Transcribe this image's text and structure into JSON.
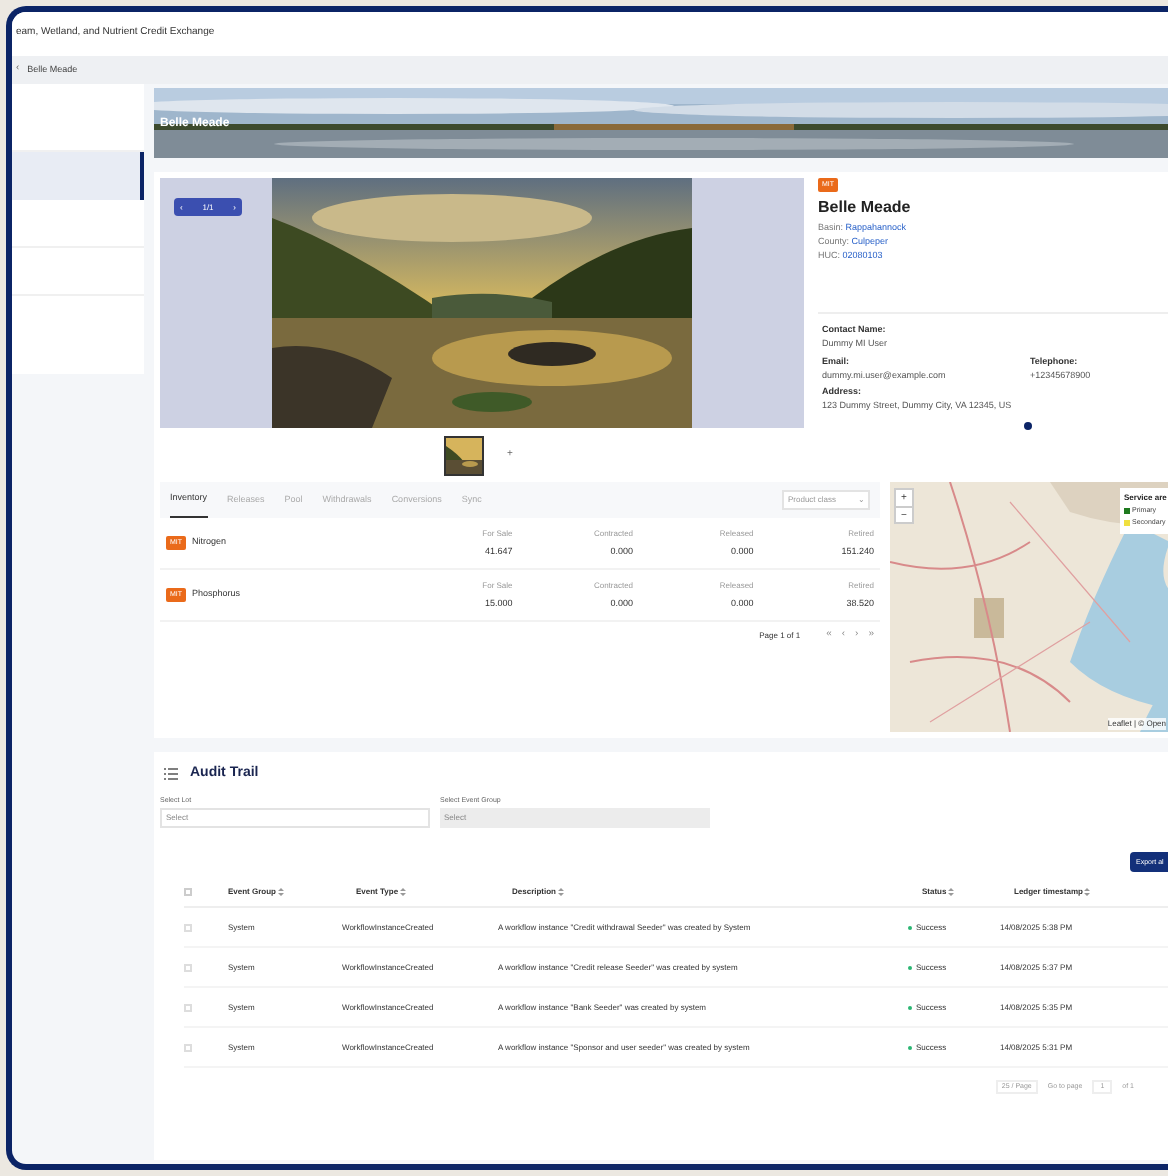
{
  "window": {
    "title": "eam, Wetland, and Nutrient Credit Exchange"
  },
  "breadcrumb": {
    "back": "‹",
    "current": "Belle Meade"
  },
  "sidebar": {
    "items": [
      {
        "selected": false
      },
      {
        "selected": true
      },
      {
        "selected": false
      },
      {
        "selected": false
      }
    ]
  },
  "banner": {
    "title": "Belle Meade"
  },
  "gallery": {
    "prev": "‹",
    "counter": "1/1",
    "next": "›",
    "thumbnails": [
      {
        "kind": "picture",
        "selected": true
      }
    ],
    "add": "+"
  },
  "site": {
    "badge": "MIT",
    "name": "Belle Meade",
    "details": [
      {
        "label": "Basin: ",
        "value": "Rappahannock"
      },
      {
        "label": "County: ",
        "value": "Culpeper"
      },
      {
        "label": "HUC: ",
        "value": "02080103"
      }
    ],
    "contact": [
      {
        "label": "Contact Name:",
        "value": "Dummy MI User"
      },
      {
        "label": "Email:",
        "value": "dummy.mi.user@example.com"
      },
      {
        "label": "Telephone:",
        "value": "+12345678900"
      },
      {
        "label": "Address:",
        "value": "123 Dummy Street, Dummy City, VA 12345, US"
      }
    ],
    "dots": [
      {
        "selected": true
      }
    ]
  },
  "tabs": [
    {
      "label": "Inventory",
      "selected": true
    },
    {
      "label": "Releases",
      "selected": false
    },
    {
      "label": "Pool",
      "selected": false
    },
    {
      "label": "Withdrawals",
      "selected": false
    },
    {
      "label": "Conversions",
      "selected": false
    },
    {
      "label": "Sync",
      "selected": false
    }
  ],
  "filter": {
    "placeholder": "Product class",
    "caret": "⌄"
  },
  "credits": [
    {
      "badge": "MIT",
      "name": "Nitrogen",
      "stats": [
        {
          "label": "For Sale",
          "value": "41.647"
        },
        {
          "label": "Contracted",
          "value": "0.000"
        },
        {
          "label": "Released",
          "value": "0.000"
        },
        {
          "label": "Retired",
          "value": "151.240"
        }
      ]
    },
    {
      "badge": "MIT",
      "name": "Phosphorus",
      "stats": [
        {
          "label": "For Sale",
          "value": "15.000"
        },
        {
          "label": "Contracted",
          "value": "0.000"
        },
        {
          "label": "Released",
          "value": "0.000"
        },
        {
          "label": "Retired",
          "value": "38.520"
        }
      ]
    }
  ],
  "pagination": {
    "text": "Page 1 of 1",
    "buttons": [
      {
        "label": "«",
        "disabled": true
      },
      {
        "label": "‹",
        "disabled": true
      },
      {
        "label": "›",
        "disabled": true
      },
      {
        "label": "»",
        "disabled": true
      }
    ]
  },
  "map": {
    "zoom_in": "+",
    "zoom_out": "−",
    "legend": {
      "title": "Service are",
      "items": [
        {
          "label": "Primary",
          "color": "#1f7a1f"
        },
        {
          "label": "Secondary",
          "color": "#f0e040"
        }
      ]
    },
    "attribution": "Leaflet | © Open"
  },
  "audit": {
    "title": "Audit Trail",
    "filters": [
      {
        "label": "Select Lot",
        "placeholder": "Select",
        "disabled": false
      },
      {
        "label": "Select Event Group",
        "placeholder": "Select",
        "disabled": true
      }
    ],
    "export": "Export al",
    "header_checked": false,
    "columns": [
      "Event Group",
      "Event Type",
      "Description",
      "Status",
      "Ledger timestamp"
    ],
    "rows": [
      {
        "checked": false,
        "group": "System",
        "type": "WorkflowInstanceCreated",
        "description": "A workflow instance \"Credit withdrawal Seeder\" was created by System",
        "status": "Success",
        "timestamp": "14/08/2025 5:38 PM"
      },
      {
        "checked": false,
        "group": "System",
        "type": "WorkflowInstanceCreated",
        "description": "A workflow instance \"Credit release Seeder\" was created by system",
        "status": "Success",
        "timestamp": "14/08/2025 5:37 PM"
      },
      {
        "checked": false,
        "group": "System",
        "type": "WorkflowInstanceCreated",
        "description": "A workflow instance \"Bank Seeder\" was created by system",
        "status": "Success",
        "timestamp": "14/08/2025 5:35 PM"
      },
      {
        "checked": false,
        "group": "System",
        "type": "WorkflowInstanceCreated",
        "description": "A workflow instance \"Sponsor and user seeder\" was created by system",
        "status": "Success",
        "timestamp": "14/08/2025 5:31 PM"
      }
    ],
    "footer": {
      "page_size": "25 / Page",
      "goto": "Go to page",
      "page": "1",
      "total": "of 1"
    }
  }
}
